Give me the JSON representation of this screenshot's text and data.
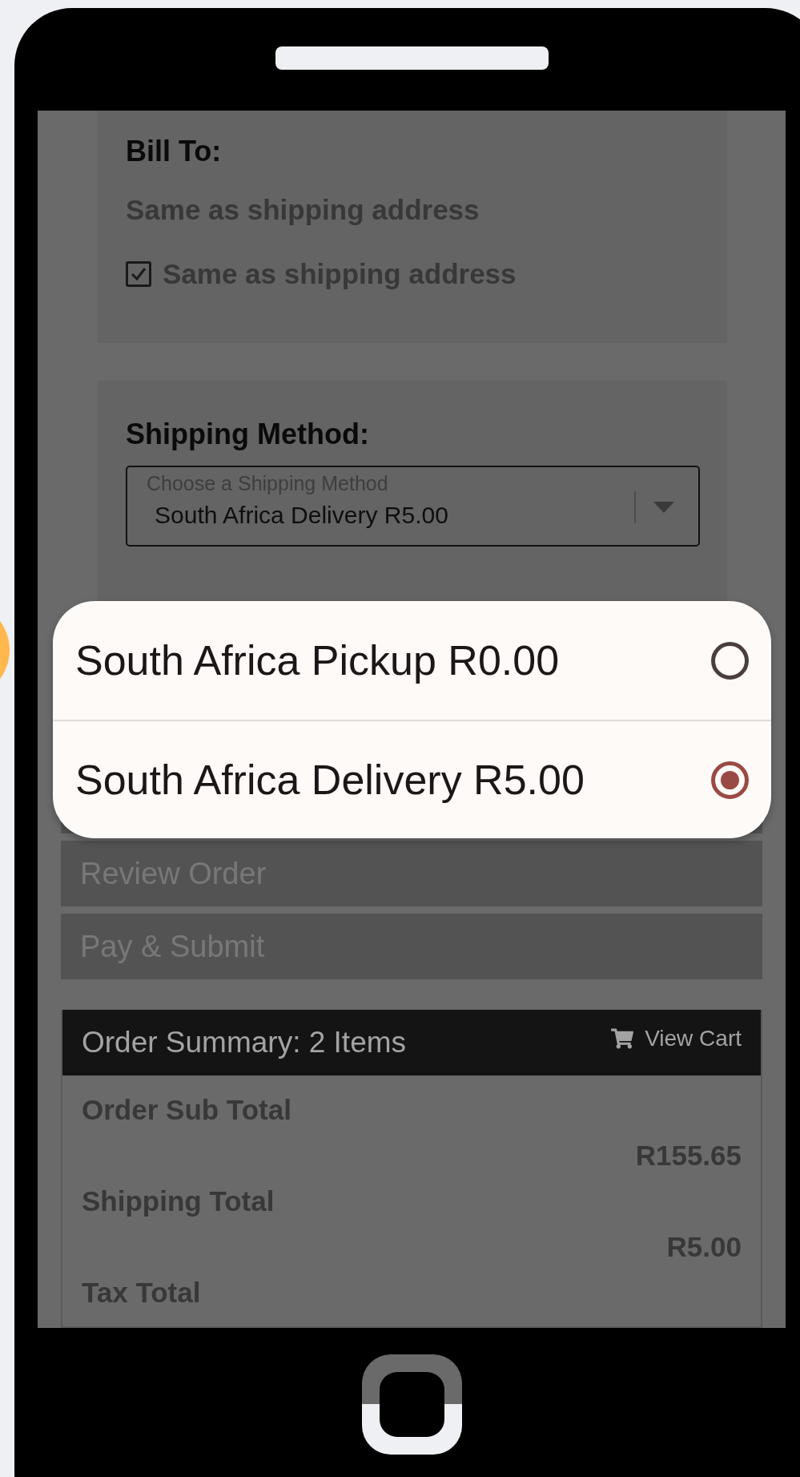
{
  "bill_to": {
    "heading": "Bill To:",
    "text": "Same as shipping address",
    "checkbox": {
      "label": "Same as shipping address",
      "checked": true
    }
  },
  "shipping_method": {
    "heading": "Shipping Method:",
    "select": {
      "label": "Choose a Shipping Method",
      "value": "South Africa Delivery R5.00"
    }
  },
  "options": [
    {
      "label": "South Africa Pickup R0.00",
      "selected": false
    },
    {
      "label": "South Africa Delivery R5.00",
      "selected": true
    }
  ],
  "steps": [
    "Review Order",
    "Pay & Submit"
  ],
  "order_summary": {
    "title": "Order Summary: 2 Items",
    "link": "View Cart",
    "rows": [
      {
        "label": "Order Sub Total",
        "value": "R155.65"
      },
      {
        "label": "Shipping Total",
        "value": "R5.00"
      },
      {
        "label": "Tax Total"
      }
    ]
  }
}
